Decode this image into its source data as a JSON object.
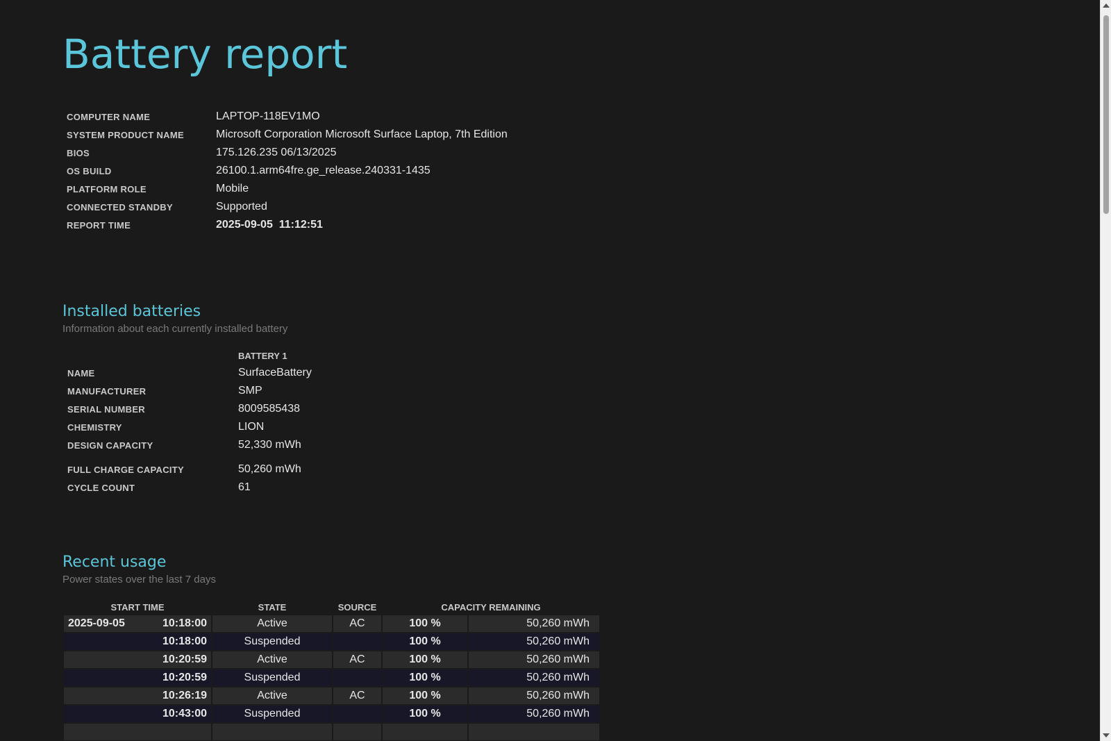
{
  "title": "Battery report",
  "system_info": [
    {
      "label": "COMPUTER NAME",
      "value": "LAPTOP-118EV1MO"
    },
    {
      "label": "SYSTEM PRODUCT NAME",
      "value": "Microsoft Corporation Microsoft Surface Laptop, 7th Edition"
    },
    {
      "label": "BIOS",
      "value": "175.126.235 06/13/2025"
    },
    {
      "label": "OS BUILD",
      "value": "26100.1.arm64fre.ge_release.240331-1435"
    },
    {
      "label": "PLATFORM ROLE",
      "value": "Mobile"
    },
    {
      "label": "CONNECTED STANDBY",
      "value": "Supported"
    },
    {
      "label": "REPORT TIME",
      "value": "2025-09-05  11:12:51"
    }
  ],
  "installed_batteries": {
    "title": "Installed batteries",
    "subtitle": "Information about each currently installed battery",
    "column_header": "BATTERY 1",
    "rows": [
      {
        "label": "NAME",
        "value": "SurfaceBattery"
      },
      {
        "label": "MANUFACTURER",
        "value": "SMP"
      },
      {
        "label": "SERIAL NUMBER",
        "value": "8009585438"
      },
      {
        "label": "CHEMISTRY",
        "value": "LION"
      },
      {
        "label": "DESIGN CAPACITY",
        "value": "52,330 mWh"
      },
      {
        "label": "FULL CHARGE CAPACITY",
        "value": "50,260 mWh"
      },
      {
        "label": "CYCLE COUNT",
        "value": "61"
      }
    ]
  },
  "recent_usage": {
    "title": "Recent usage",
    "subtitle": "Power states over the last 7 days",
    "headers": {
      "start_time": "START TIME",
      "state": "STATE",
      "source": "SOURCE",
      "capacity": "CAPACITY REMAINING"
    },
    "rows": [
      {
        "date": "2025-09-05",
        "time": "10:18:00",
        "state": "Active",
        "source": "AC",
        "percent": "100 %",
        "mwh": "50,260 mWh"
      },
      {
        "date": "",
        "time": "10:18:00",
        "state": "Suspended",
        "source": "",
        "percent": "100 %",
        "mwh": "50,260 mWh"
      },
      {
        "date": "",
        "time": "10:20:59",
        "state": "Active",
        "source": "AC",
        "percent": "100 %",
        "mwh": "50,260 mWh"
      },
      {
        "date": "",
        "time": "10:20:59",
        "state": "Suspended",
        "source": "",
        "percent": "100 %",
        "mwh": "50,260 mWh"
      },
      {
        "date": "",
        "time": "10:26:19",
        "state": "Active",
        "source": "AC",
        "percent": "100 %",
        "mwh": "50,260 mWh"
      },
      {
        "date": "",
        "time": "10:43:00",
        "state": "Suspended",
        "source": "",
        "percent": "100 %",
        "mwh": "50,260 mWh"
      }
    ]
  }
}
